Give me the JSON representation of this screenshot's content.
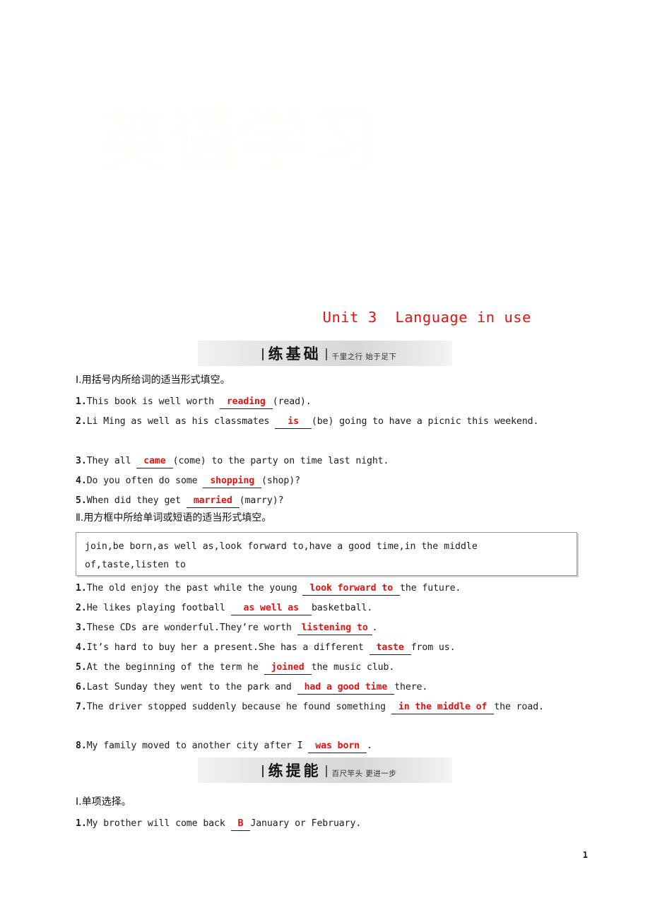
{
  "document": {
    "unit_title": "Unit 3  Language in use",
    "title_color": "#e8110f",
    "page_number": "1",
    "watermark": "英语学习"
  },
  "sections": [
    {
      "banner_main": "练基础",
      "banner_sub": "千里之行  始于足下",
      "parts": [
        {
          "heading": "Ⅰ.用括号内所给词的适当形式填空。",
          "questions": [
            {
              "num": "1.",
              "pre": "This book is well worth ",
              "answer": "reading",
              "post": "(read)."
            },
            {
              "num": "2.",
              "pre": "Li Ming as well as his classmates ",
              "answer": "is",
              "post": "(be) going to have a picnic this weekend."
            },
            {
              "num": "3.",
              "pre": "They all ",
              "answer": "came",
              "post": "(come) to the party on time last night."
            },
            {
              "num": "4.",
              "pre": "Do you often do some ",
              "answer": "shopping",
              "post": "(shop)?"
            },
            {
              "num": "5.",
              "pre": "When did they get ",
              "answer": "married",
              "post": "(marry)?"
            }
          ]
        },
        {
          "heading": "Ⅱ.用方框中所给单词或短语的适当形式填空。",
          "word_bank": "join,be born,as well as,look forward to,have a good time,in the middle of,taste,listen to",
          "questions": [
            {
              "num": "1.",
              "pre": "The old enjoy the past while the young ",
              "answer": "look forward to",
              "post": "the future."
            },
            {
              "num": "2.",
              "pre": "He likes playing football ",
              "answer": "as well as",
              "post": "basketball."
            },
            {
              "num": "3.",
              "pre": "These CDs are wonderful.They’re worth ",
              "answer": "listening to",
              "post": "."
            },
            {
              "num": "4.",
              "pre": "It’s hard to buy her a present.She has a different ",
              "answer": "taste",
              "post": "from us."
            },
            {
              "num": "5.",
              "pre": "At the beginning of the term he ",
              "answer": "joined",
              "post": "the music club."
            },
            {
              "num": "6.",
              "pre": "Last Sunday they went to the park and ",
              "answer": "had a good time",
              "post": "there."
            },
            {
              "num": "7.",
              "pre": "The driver stopped suddenly because he found something ",
              "answer": "in the middle of",
              "post": "the road."
            },
            {
              "num": "8.",
              "pre": "My family moved to another city after I ",
              "answer": "was born",
              "post": "."
            }
          ]
        }
      ]
    },
    {
      "banner_main": "练提能",
      "banner_sub": "百尺竿头  更进一步",
      "parts": [
        {
          "heading": "Ⅰ.单项选择。",
          "questions": [
            {
              "num": "1.",
              "pre": "My brother will come back ",
              "answer": "B",
              "post": "January or February."
            }
          ]
        }
      ]
    }
  ]
}
